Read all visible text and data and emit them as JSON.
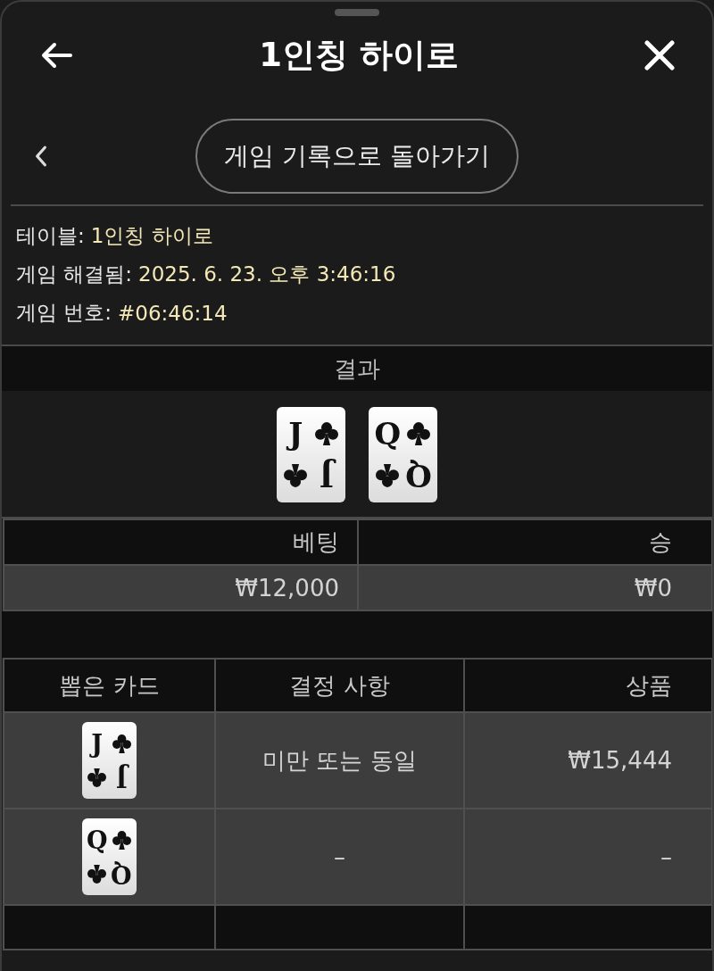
{
  "sheet": {
    "title": "1인칭 하이로"
  },
  "nav": {
    "back_label": "게임 기록으로 돌아가기"
  },
  "game_details": [
    {
      "label": "테이블:",
      "value": "1인칭 하이로"
    },
    {
      "label": "게임 해결됨:",
      "value": "2025. 6. 23. 오후 3:46:16"
    },
    {
      "label": "게임 번호:",
      "value": "#06:46:14"
    }
  ],
  "result": {
    "heading": "결과",
    "cards": [
      {
        "rank_top": "J",
        "rank_bottom": "J"
      },
      {
        "rank_top": "Q",
        "rank_bottom": "Q"
      }
    ]
  },
  "summary_table": {
    "columns": [
      "베팅",
      "승"
    ],
    "rows": [
      [
        "₩12,000",
        "₩0"
      ]
    ]
  },
  "draws_table": {
    "columns": [
      "뽑은 카드",
      "결정 사항",
      "상품"
    ],
    "rows": [
      {
        "card": {
          "rank_top": "J",
          "rank_bottom": "J"
        },
        "decision": "미만 또는 동일",
        "prize": "₩15,444"
      },
      {
        "card": {
          "rank_top": "Q",
          "rank_bottom": "Q"
        },
        "decision": "–",
        "prize": "–"
      }
    ]
  }
}
